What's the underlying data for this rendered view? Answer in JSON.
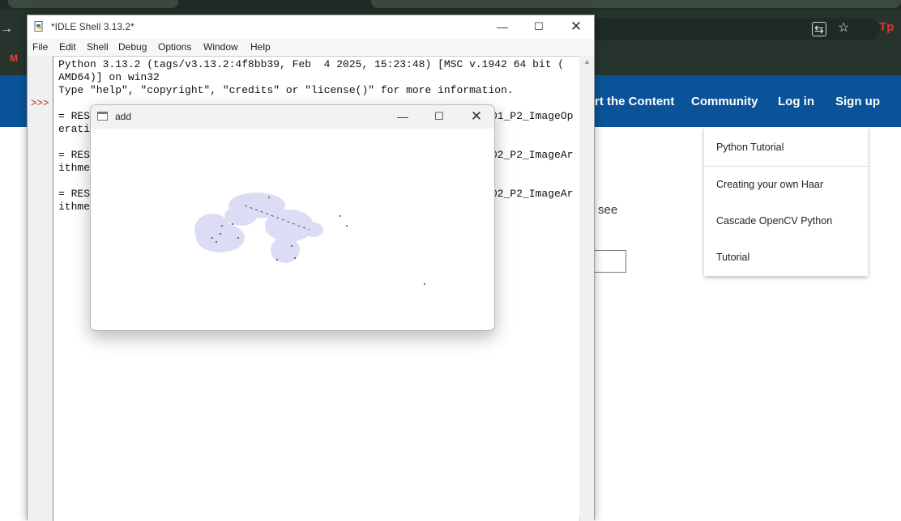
{
  "browser": {
    "icons": [
      "back-arrow-icon",
      "translate-icon",
      "star-icon",
      "extension-tp-icon",
      "gmail-icon"
    ],
    "toolbar_extension_label": "Tp",
    "nav_links": [
      "rt the Content",
      "Community",
      "Log in",
      "Sign up"
    ],
    "dropdown_items": [
      "Python Tutorial",
      "Creating your own Haar",
      "Cascade OpenCV Python",
      "Tutorial"
    ],
    "page_text_fragment": "see",
    "colors": {
      "nav_bar": "#0b5398",
      "toolbar": "#26342d"
    }
  },
  "idle": {
    "title": "*IDLE Shell 3.13.2*",
    "menu": [
      "File",
      "Edit",
      "Shell",
      "Debug",
      "Options",
      "Window",
      "Help"
    ],
    "prompt": ">>>",
    "lines": [
      "Python 3.13.2 (tags/v3.13.2:4f8bb39, Feb  4 2025, 15:23:48) [MSC v.1942 64 bit (",
      "AMD64)] on win32",
      "Type \"help\", \"copyright\", \"credits\" or \"license()\" for more information.",
      "= RES",
      "erati",
      "= RES",
      "ithme",
      "= RES",
      "ithme"
    ],
    "right_fragments": [
      "01_P2_ImageOp",
      "02_P2_ImageAr",
      "02_P2_ImageAr"
    ]
  },
  "add_window": {
    "title": "add"
  }
}
